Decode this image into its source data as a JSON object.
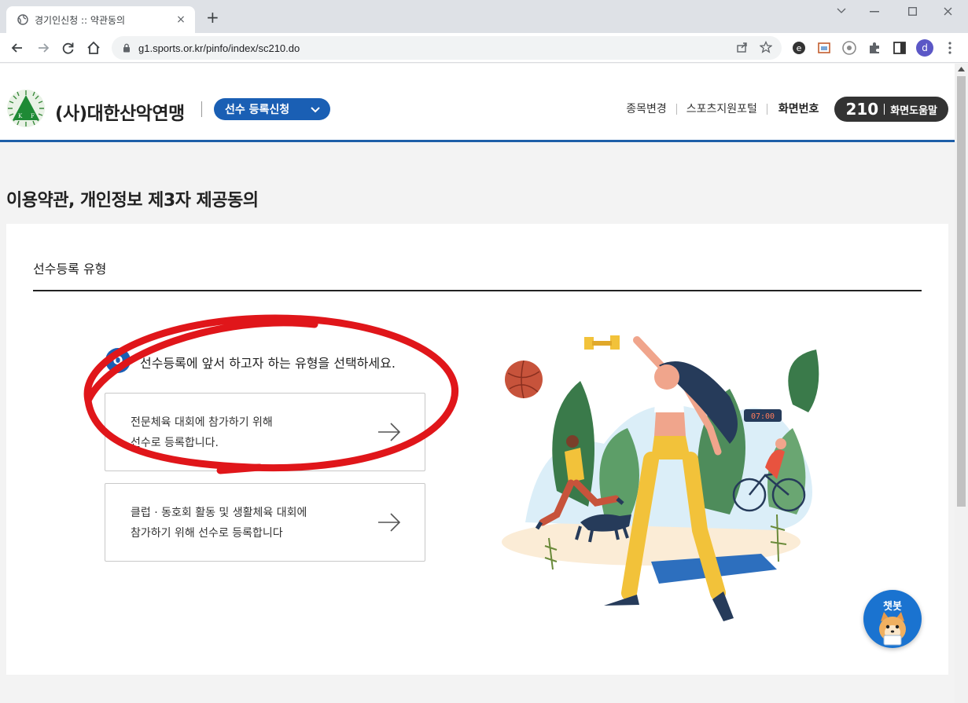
{
  "browser": {
    "tab_title": "경기인신청 :: 약관동의",
    "tab_close": "×",
    "new_tab": "+",
    "url": "g1.sports.or.kr/pinfo/index/sc210.do",
    "profile_initial": "d"
  },
  "header": {
    "org_name": "(사)대한산악연맹",
    "menu_label": "선수 등록신청",
    "links": [
      "종목변경",
      "스포츠지원포털"
    ],
    "screen_label": "화면번호",
    "screen_number": "210",
    "screen_help": "화면도움말"
  },
  "page": {
    "title": "이용약관, 개인정보 제3자 제공동의",
    "section_label": "선수등록 유형",
    "question_badge": "Q",
    "question": "선수등록에 앞서 하고자 하는 유형을 선택하세요.",
    "options": [
      {
        "line1": "전문체육 대회에 참가하기 위해",
        "line2": "선수로 등록합니다."
      },
      {
        "line1": "클럽 · 동호회 활동 및 생활체육 대회에",
        "line2": "참가하기 위해 선수로 등록합니다"
      }
    ]
  },
  "chatbot": {
    "label": "챗봇"
  },
  "colors": {
    "brand": "#1a5fb4",
    "annotation": "#e0161a",
    "dark_pill": "#333333"
  }
}
